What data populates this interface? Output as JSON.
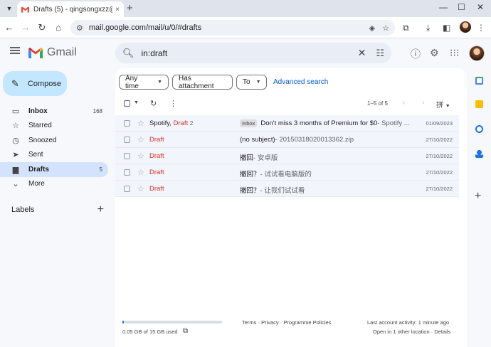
{
  "browser": {
    "tab_title": "Drafts (5) - qingsongxzz@gmail.com",
    "address": "mail.google.com/mail/u/0/#drafts",
    "new_tab": "+",
    "tab_close": "×"
  },
  "gmail": {
    "product_name": "Gmail",
    "search_query": "in:draft",
    "compose_label": "Compose",
    "nav": [
      {
        "icon": "inbox-icon",
        "label": "Inbox",
        "count": "168",
        "bold": true,
        "active": false
      },
      {
        "icon": "star-icon",
        "label": "Starred",
        "count": "",
        "bold": false,
        "active": false
      },
      {
        "icon": "clock-icon",
        "label": "Snoozed",
        "count": "",
        "bold": false,
        "active": false
      },
      {
        "icon": "send-icon",
        "label": "Sent",
        "count": "",
        "bold": false,
        "active": false
      },
      {
        "icon": "draft-icon",
        "label": "Drafts",
        "count": "5",
        "bold": true,
        "active": true
      },
      {
        "icon": "chevron-down-icon",
        "label": "More",
        "count": "",
        "bold": false,
        "active": false
      }
    ],
    "labels_heading": "Labels",
    "filters": {
      "any_time": "Any time",
      "has_attachment": "Has attachment",
      "to": "To",
      "advanced_search": "Advanced search"
    },
    "pagination": "1–5 of 5",
    "input_tool": "拼",
    "rows": [
      {
        "from": "Spotify,",
        "draft": "Draft",
        "count": "2",
        "badge": "Inbox",
        "subject": "Don't miss 3 months of Premium for $0",
        "snippet": " - Spotify ...",
        "date": "01/09/2023"
      },
      {
        "from": "",
        "draft": "Draft",
        "count": "",
        "badge": "",
        "subject": "(no subject)",
        "snippet": " - 20150318020013362.zip",
        "date": "27/10/2022"
      },
      {
        "from": "",
        "draft": "Draft",
        "count": "",
        "badge": "",
        "subject": "撤回",
        "snippet": " - 安卓版",
        "date": "27/10/2022"
      },
      {
        "from": "",
        "draft": "Draft",
        "count": "",
        "badge": "",
        "subject": "撤回？",
        "snippet": " - 试试看电脑版的",
        "date": "27/10/2022"
      },
      {
        "from": "",
        "draft": "Draft",
        "count": "",
        "badge": "",
        "subject": "撤回？",
        "snippet": " - 让我们试试看",
        "date": "27/10/2022"
      }
    ],
    "footer": {
      "storage": "0.05 GB of 15 GB used",
      "storage_fraction": 0.003,
      "links": "Terms · Privacy · Programme Policies",
      "activity": "Last account activity: 1 minute ago",
      "location": "Open in 1 other location · Details"
    }
  }
}
